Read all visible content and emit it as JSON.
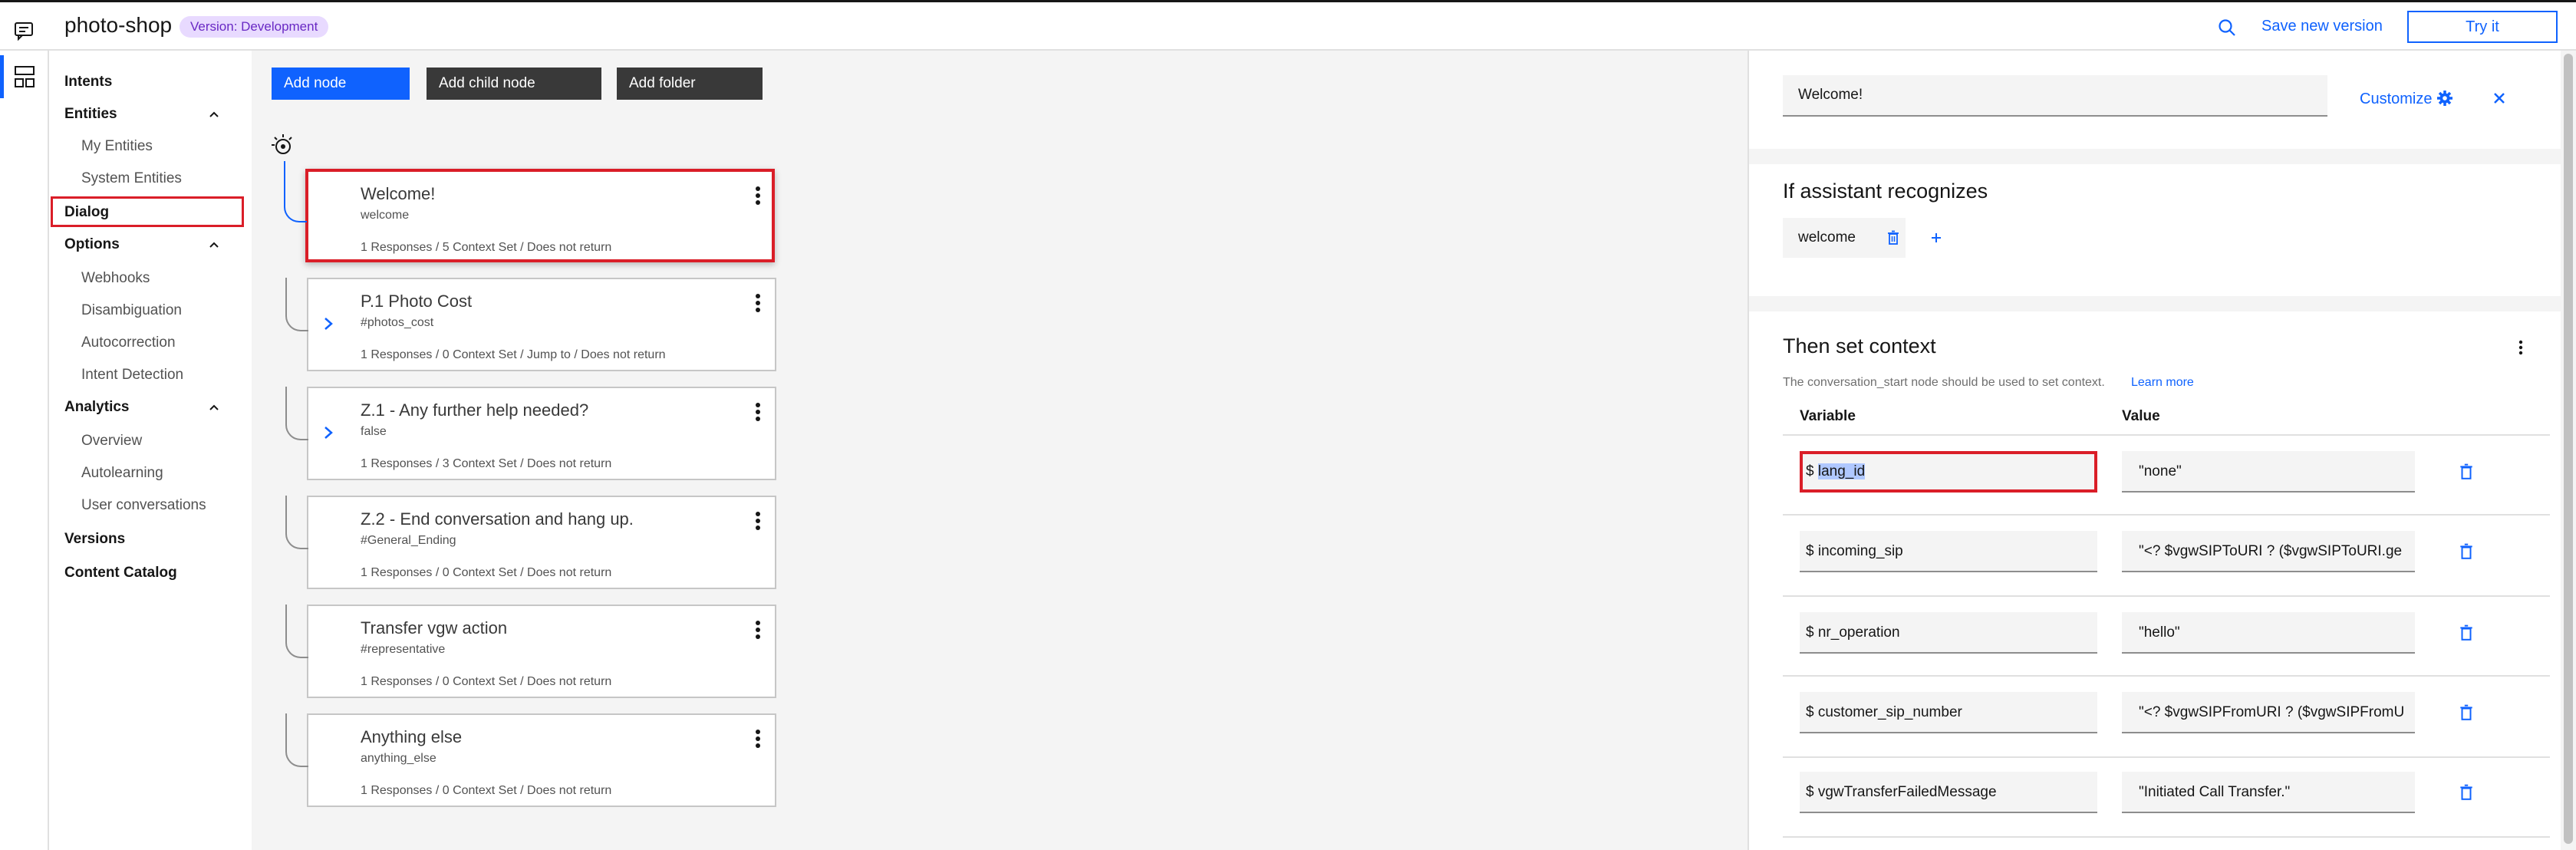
{
  "header": {
    "app_name": "photo-shop",
    "version_badge": "Version: Development",
    "save_version": "Save new version",
    "try_it": "Try it"
  },
  "sidenav": {
    "intents": "Intents",
    "entities": "Entities",
    "my_entities": "My Entities",
    "system_entities": "System Entities",
    "dialog": "Dialog",
    "options": "Options",
    "webhooks": "Webhooks",
    "disambiguation": "Disambiguation",
    "autocorrection": "Autocorrection",
    "intent_detection": "Intent Detection",
    "analytics": "Analytics",
    "overview": "Overview",
    "autolearning": "Autolearning",
    "user_conversations": "User conversations",
    "versions": "Versions",
    "content_catalog": "Content Catalog"
  },
  "toolbar": {
    "add_node": "Add node",
    "add_child_node": "Add child node",
    "add_folder": "Add folder"
  },
  "nodes": [
    {
      "title": "Welcome!",
      "condition": "welcome",
      "summary": "1 Responses / 5 Context Set / Does not return"
    },
    {
      "title": "P.1 Photo Cost",
      "condition": "#photos_cost",
      "summary": "1 Responses / 0 Context Set / Jump to / Does not return"
    },
    {
      "title": "Z.1 - Any further help needed?",
      "condition": "false",
      "summary": "1 Responses / 3 Context Set / Does not return"
    },
    {
      "title": "Z.2 - End conversation and hang up.",
      "condition": "#General_Ending",
      "summary": "1 Responses / 0 Context Set / Does not return"
    },
    {
      "title": "Transfer vgw action",
      "condition": "#representative",
      "summary": "1 Responses / 0 Context Set / Does not return"
    },
    {
      "title": "Anything else",
      "condition": "anything_else",
      "summary": "1 Responses / 0 Context Set / Does not return"
    }
  ],
  "panel": {
    "node_name": "Welcome!",
    "customize": "Customize",
    "recognizes_heading": "If assistant recognizes",
    "condition_chip": "welcome",
    "context_heading": "Then set context",
    "context_note": "The conversation_start node should be used to set context.",
    "learn_more": "Learn more",
    "col_variable": "Variable",
    "col_value": "Value",
    "dollar": "$",
    "rows": [
      {
        "variable": "lang_id",
        "value": "\"none\""
      },
      {
        "variable": "incoming_sip",
        "value": "\"<? $vgwSIPToURI ? ($vgwSIPToURI.ge"
      },
      {
        "variable": "nr_operation",
        "value": "\"hello\""
      },
      {
        "variable": "customer_sip_number",
        "value": "\"<? $vgwSIPFromURI ? ($vgwSIPFromU"
      },
      {
        "variable": "vgwTransferFailedMessage",
        "value": "\"Initiated Call Transfer.\""
      }
    ]
  }
}
